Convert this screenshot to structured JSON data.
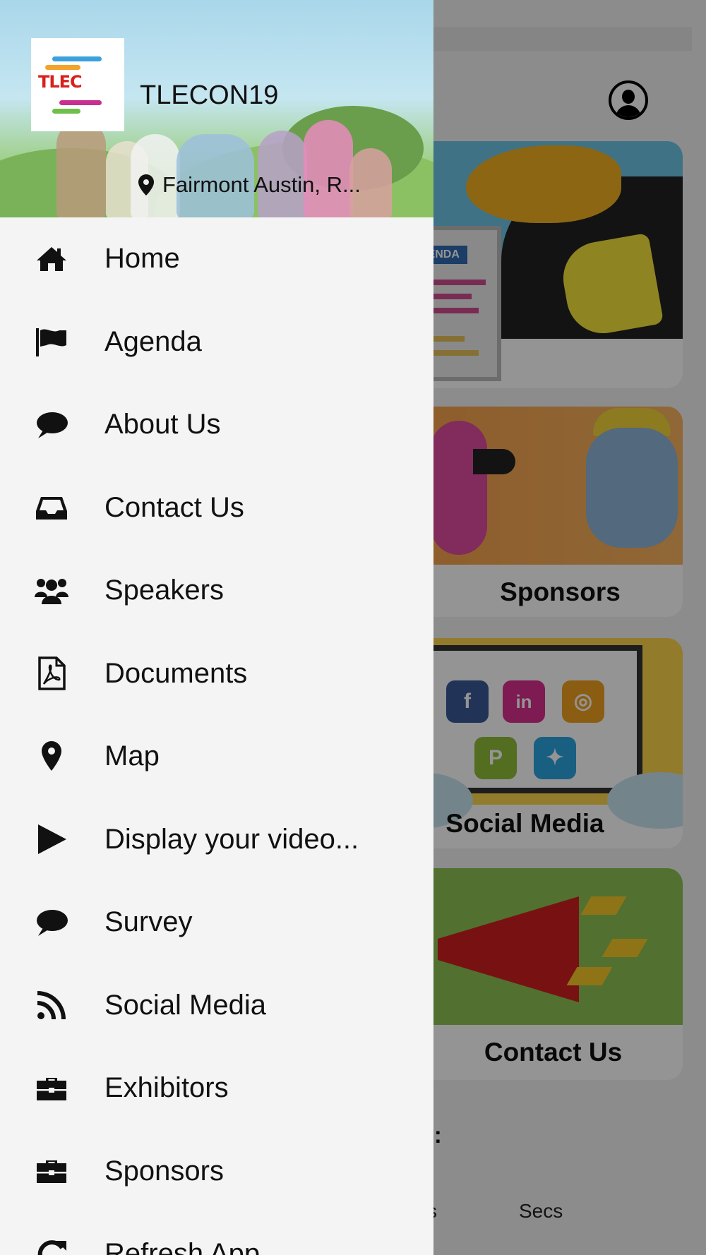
{
  "drawer": {
    "event_name": "TLECON19",
    "location": "Fairmont Austin, R...",
    "menu": [
      {
        "label": "Home",
        "icon": "home-icon"
      },
      {
        "label": "Agenda",
        "icon": "flag-icon"
      },
      {
        "label": "About Us",
        "icon": "chat-bubble-icon"
      },
      {
        "label": "Contact Us",
        "icon": "inbox-icon"
      },
      {
        "label": "Speakers",
        "icon": "users-icon"
      },
      {
        "label": "Documents",
        "icon": "pdf-file-icon"
      },
      {
        "label": "Map",
        "icon": "map-pin-icon"
      },
      {
        "label": "Display your video...",
        "icon": "play-icon"
      },
      {
        "label": "Survey",
        "icon": "chat-bubble-icon"
      },
      {
        "label": "Social Media",
        "icon": "rss-icon"
      },
      {
        "label": "Exhibitors",
        "icon": "briefcase-icon"
      },
      {
        "label": "Sponsors",
        "icon": "briefcase-icon"
      },
      {
        "label": "Refresh App",
        "icon": "refresh-icon"
      }
    ]
  },
  "background": {
    "tiles": [
      "Sponsors",
      "Social Media",
      "Contact Us"
    ],
    "agenda_tag": "GENDA",
    "footer_colon": ":",
    "footer_s": "s",
    "footer_secs": "Secs"
  },
  "colors": {
    "overlay": "rgba(0,0,0,0.42)",
    "drawer_bg": "#f4f4f4",
    "header_sky": "#a9d7ea"
  }
}
